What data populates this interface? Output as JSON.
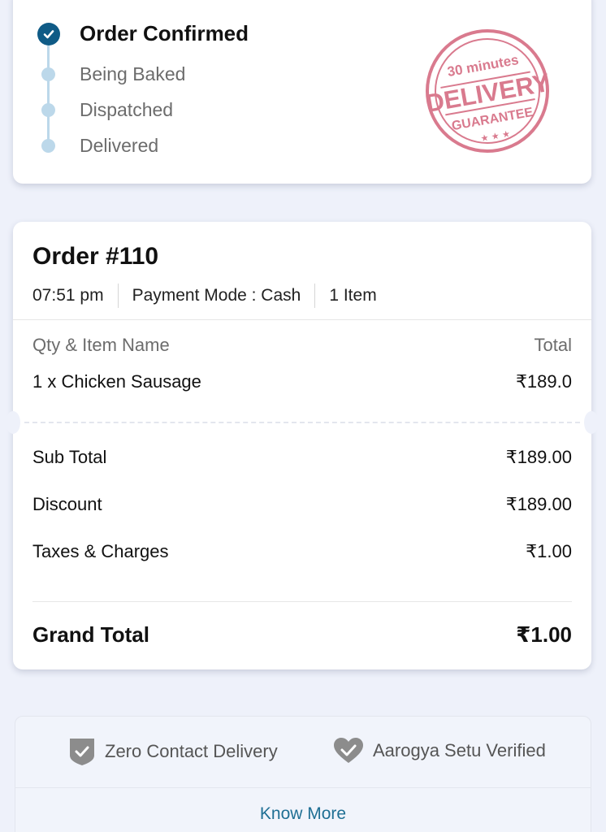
{
  "tracker": {
    "steps": [
      {
        "label": "Order Confirmed",
        "state": "done"
      },
      {
        "label": "Being Baked",
        "state": "pending"
      },
      {
        "label": "Dispatched",
        "state": "pending"
      },
      {
        "label": "Delivered",
        "state": "pending"
      }
    ],
    "stamp": {
      "top_text": "30 minutes",
      "main_text": "DELIVERY",
      "bottom_text": "GUARANTEE",
      "color": "#d97a8e"
    },
    "accent_color": "#0f5b86",
    "line_color": "#bcd8ea"
  },
  "order": {
    "title": "Order #110",
    "time": "07:51 pm",
    "payment_mode": "Payment Mode : Cash",
    "item_count": "1 Item",
    "items_header": {
      "left": "Qty & Item Name",
      "right": "Total"
    },
    "items": [
      {
        "name": "1 x Chicken Sausage",
        "total": "₹189.0"
      }
    ],
    "summary": [
      {
        "label": "Sub Total",
        "value": "₹189.00"
      },
      {
        "label": "Discount",
        "value": "₹189.00"
      },
      {
        "label": "Taxes & Charges",
        "value": "₹1.00"
      }
    ],
    "grand_total": {
      "label": "Grand Total",
      "value": "₹1.00"
    }
  },
  "safety": {
    "badges": [
      {
        "label": "Zero Contact Delivery",
        "icon": "shield-check-icon"
      },
      {
        "label": "Aarogya Setu Verified",
        "icon": "heart-check-icon"
      }
    ],
    "link": "Know More",
    "link_color": "#1f6f94"
  }
}
